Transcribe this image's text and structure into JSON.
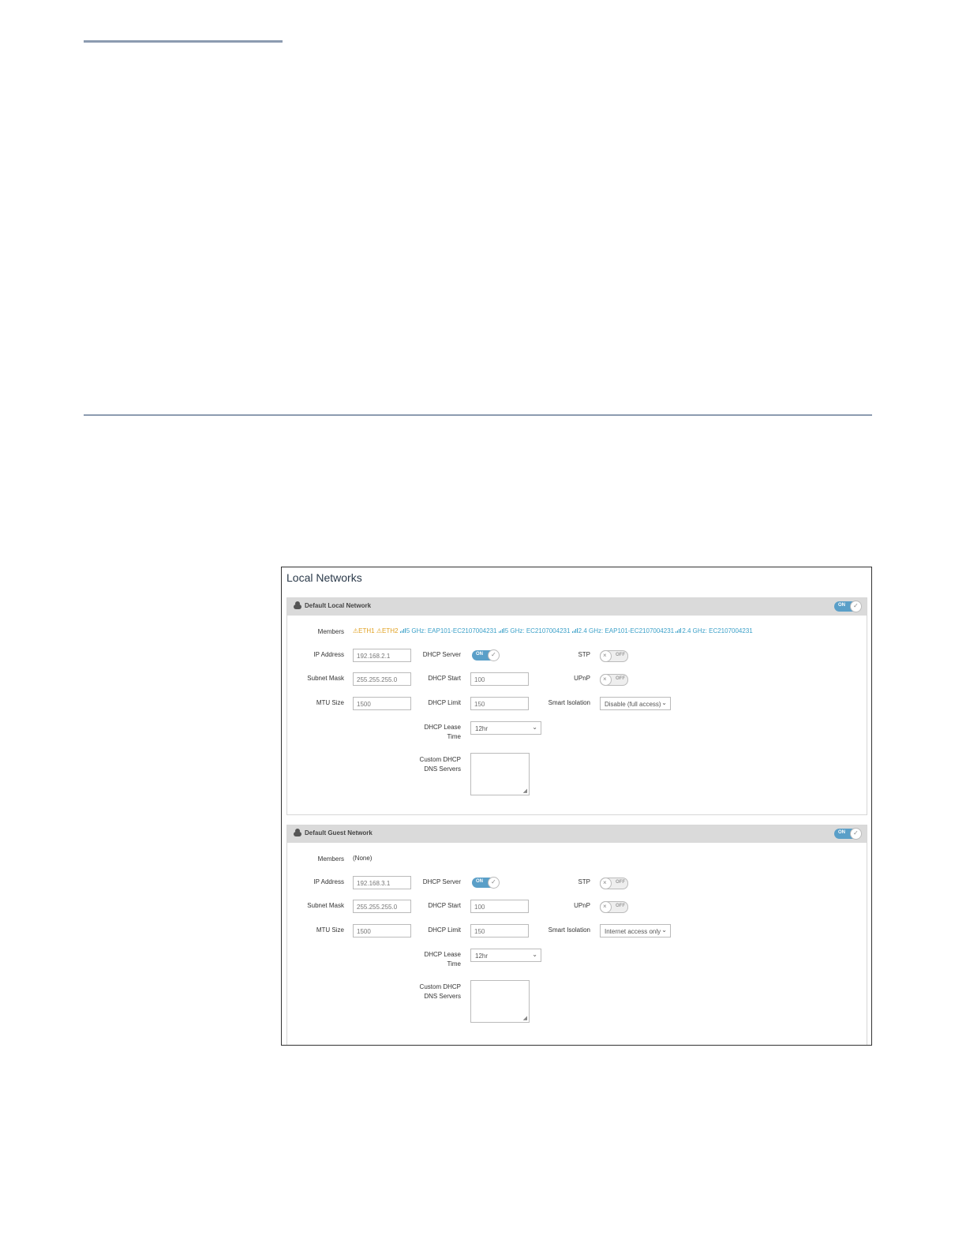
{
  "window_title": "Local Networks",
  "networks": [
    {
      "name": "Default Local Network",
      "enabled_label": "ON",
      "labels": {
        "members": "Members",
        "ip": "IP Address",
        "subnet": "Subnet Mask",
        "mtu": "MTU Size",
        "dhcp_server": "DHCP Server",
        "dhcp_start": "DHCP Start",
        "dhcp_limit": "DHCP Limit",
        "lease": "DHCP Lease Time",
        "dns": "Custom DHCP DNS Servers",
        "stp": "STP",
        "upnp": "UPnP",
        "isolation": "Smart Isolation"
      },
      "members": [
        {
          "type": "eth",
          "label": "ETH1"
        },
        {
          "type": "eth",
          "label": "ETH2"
        },
        {
          "type": "wifi",
          "label": "5 GHz: EAP101-EC2107004231"
        },
        {
          "type": "wifi",
          "label": "5 GHz: EC2107004231"
        },
        {
          "type": "wifi",
          "label": "2.4 GHz: EAP101-EC2107004231"
        },
        {
          "type": "wifi",
          "label": "2.4 GHz: EC2107004231"
        }
      ],
      "ip_address": "192.168.2.1",
      "subnet_mask": "255.255.255.0",
      "mtu_size": "1500",
      "dhcp_server_label": "ON",
      "dhcp_start": "100",
      "dhcp_limit": "150",
      "lease_time": "12hr",
      "stp_label": "OFF",
      "upnp_label": "OFF",
      "smart_isolation": "Disable (full access)"
    },
    {
      "name": "Default Guest Network",
      "enabled_label": "ON",
      "labels": {
        "members": "Members",
        "ip": "IP Address",
        "subnet": "Subnet Mask",
        "mtu": "MTU Size",
        "dhcp_server": "DHCP Server",
        "dhcp_start": "DHCP Start",
        "dhcp_limit": "DHCP Limit",
        "lease": "DHCP Lease Time",
        "dns": "Custom DHCP DNS Servers",
        "stp": "STP",
        "upnp": "UPnP",
        "isolation": "Smart Isolation"
      },
      "members_none": "(None)",
      "ip_address": "192.168.3.1",
      "subnet_mask": "255.255.255.0",
      "mtu_size": "1500",
      "dhcp_server_label": "ON",
      "dhcp_start": "100",
      "dhcp_limit": "150",
      "lease_time": "12hr",
      "stp_label": "OFF",
      "upnp_label": "OFF",
      "smart_isolation": "Internet access only"
    }
  ],
  "colors": {
    "accent": "#5a9fc8",
    "eth": "#e0a020",
    "wifi": "#3ba0c8",
    "header_bg": "#dadada",
    "rule": "#8c9bb0"
  },
  "icons": {
    "network": "cloud-icon",
    "eth_warning": "warning-icon",
    "wifi": "signal-icon",
    "toggle_on": "check-icon",
    "toggle_off": "x-icon"
  }
}
